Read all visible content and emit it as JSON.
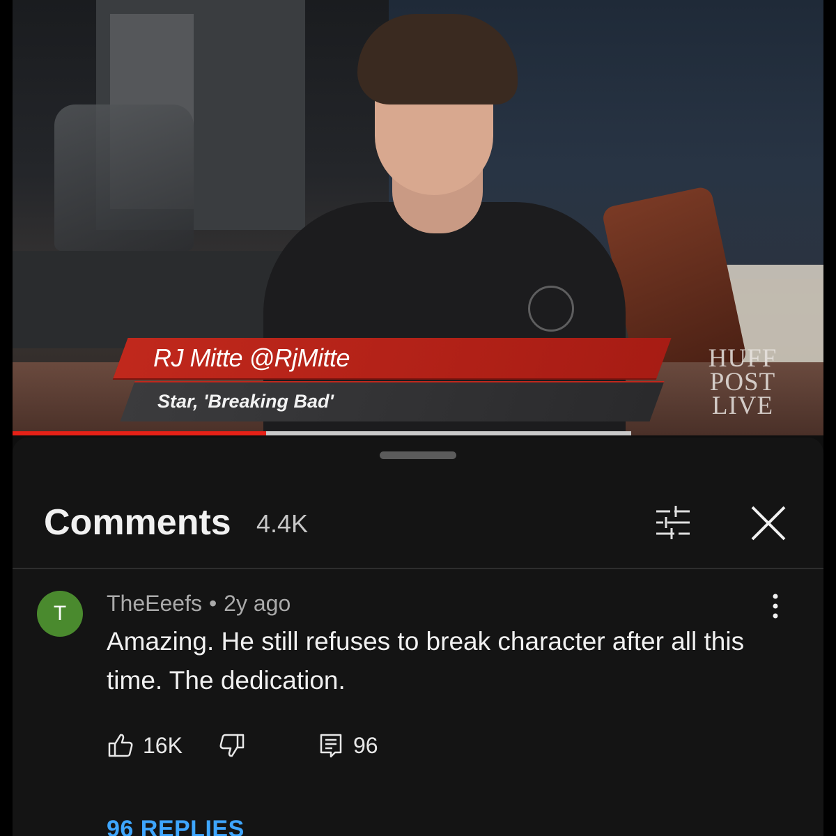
{
  "video": {
    "lower_third": {
      "name": "RJ Mitte @RjMitte",
      "subtitle": "Star, 'Breaking Bad'"
    },
    "network_logo": [
      "HUFF",
      "POST",
      "LIVE"
    ],
    "progress_fraction": 0.41,
    "colors": {
      "progress": "#e62117",
      "lower_third_red": "#c0281c"
    }
  },
  "comments_panel": {
    "title": "Comments",
    "count": "4.4K",
    "icons": {
      "filter": "filter-sliders-icon",
      "close": "close-icon"
    },
    "comment": {
      "avatar_letter": "T",
      "author": "TheEeefs",
      "separator": "•",
      "time": "2y ago",
      "text": "Amazing. He still refuses to break character after all this time. The dedication.",
      "likes": "16K",
      "replies_count": "96",
      "replies_link": "96 REPLIES",
      "avatar_color": "#4a8a2e"
    },
    "colors": {
      "link": "#3ea6ff",
      "background": "#141414"
    }
  }
}
